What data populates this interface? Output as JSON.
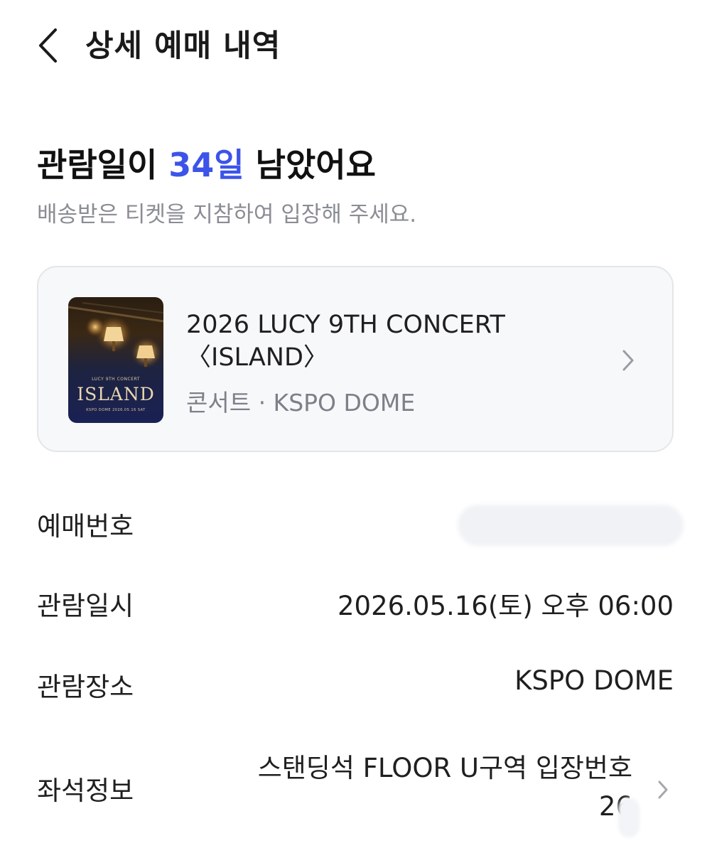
{
  "header": {
    "title": "상세 예매 내역",
    "back_icon": "chevron-left-icon"
  },
  "summary": {
    "headline_prefix": "관람일이 ",
    "days_left": "34일",
    "headline_suffix": " 남았어요",
    "subline": "배송받은 티켓을 지참하여 입장해 주세요.",
    "accent_color": "#3d54e8"
  },
  "event_card": {
    "poster": {
      "header_text": "LUCY 9TH CONCERT",
      "title_text": "ISLAND",
      "footer_text": "KSPO DOME  2026.05.16 SAT"
    },
    "title": "2026 LUCY 9TH CONCERT 〈ISLAND〉",
    "meta": "콘서트 · KSPO DOME",
    "chevron_icon": "chevron-right-icon"
  },
  "details": {
    "booking_number": {
      "label": "예매번호",
      "value": ""
    },
    "show_datetime": {
      "label": "관람일시",
      "value": "2026.05.16(토) 오후 06:00"
    },
    "venue": {
      "label": "관람장소",
      "value": "KSPO DOME"
    },
    "seat": {
      "label": "좌석정보",
      "value": "스탠딩석 FLOOR U구역 입장번호 26"
    }
  }
}
